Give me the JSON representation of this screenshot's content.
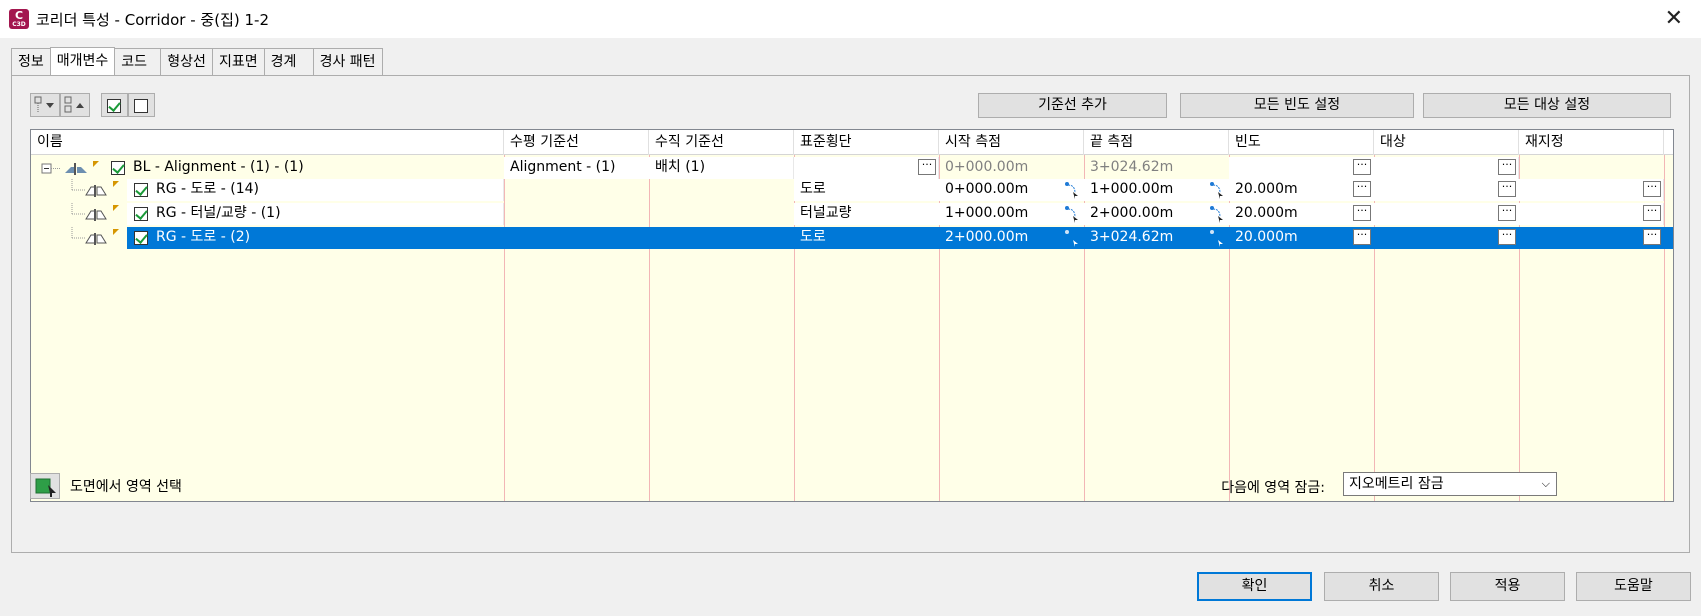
{
  "window": {
    "title": "코리더 특성 - Corridor - 중(집) 1-2",
    "app_icon_letter": "C",
    "app_icon_sub": "C3D"
  },
  "tabs": [
    {
      "label": "정보"
    },
    {
      "label": "매개변수"
    },
    {
      "label": "코드"
    },
    {
      "label": "형상선"
    },
    {
      "label": "지표면"
    },
    {
      "label": "경계"
    },
    {
      "label": "경사 패턴"
    }
  ],
  "toolbar": {
    "add_baseline": "기준선 추가",
    "set_all_frequency": "모든 빈도 설정",
    "set_all_targets": "모든 대상 설정"
  },
  "grid": {
    "columns": [
      "이름",
      "수평 기준선",
      "수직 기준선",
      "표준횡단",
      "시작 측점",
      "끝 측점",
      "빈도",
      "대상",
      "재지정"
    ],
    "rows": [
      {
        "name": "BL - Alignment - (1) - (1)",
        "horizontal": "Alignment - (1)",
        "vertical": "배치 (1)",
        "assembly": "",
        "start": "0+000.00m",
        "end": "3+024.62m",
        "frequency": "",
        "checked": true,
        "selected": false,
        "level": 0
      },
      {
        "name": "RG - 도로 - (14)",
        "horizontal": "",
        "vertical": "",
        "assembly": "도로",
        "start": "0+000.00m",
        "end": "1+000.00m",
        "frequency": "20.000m",
        "checked": true,
        "selected": false,
        "level": 1
      },
      {
        "name": "RG - 터널/교량 - (1)",
        "horizontal": "",
        "vertical": "",
        "assembly": "터널교량",
        "start": "1+000.00m",
        "end": "2+000.00m",
        "frequency": "20.000m",
        "checked": true,
        "selected": false,
        "level": 1
      },
      {
        "name": "RG - 도로 - (2)",
        "horizontal": "",
        "vertical": "",
        "assembly": "도로",
        "start": "2+000.00m",
        "end": "3+024.62m",
        "frequency": "20.000m",
        "checked": true,
        "selected": true,
        "level": 1
      }
    ]
  },
  "footer": {
    "select_region_label": "도면에서 영역 선택",
    "lock_label": "다음에 영역 잠금:",
    "lock_value": "지오메트리 잠금"
  },
  "buttons": {
    "ok": "확인",
    "cancel": "취소",
    "apply": "적용",
    "help": "도움말"
  },
  "colors": {
    "accent": "#0078d7",
    "grid_bg": "#ffffe8",
    "app_icon": "#a3174f"
  }
}
